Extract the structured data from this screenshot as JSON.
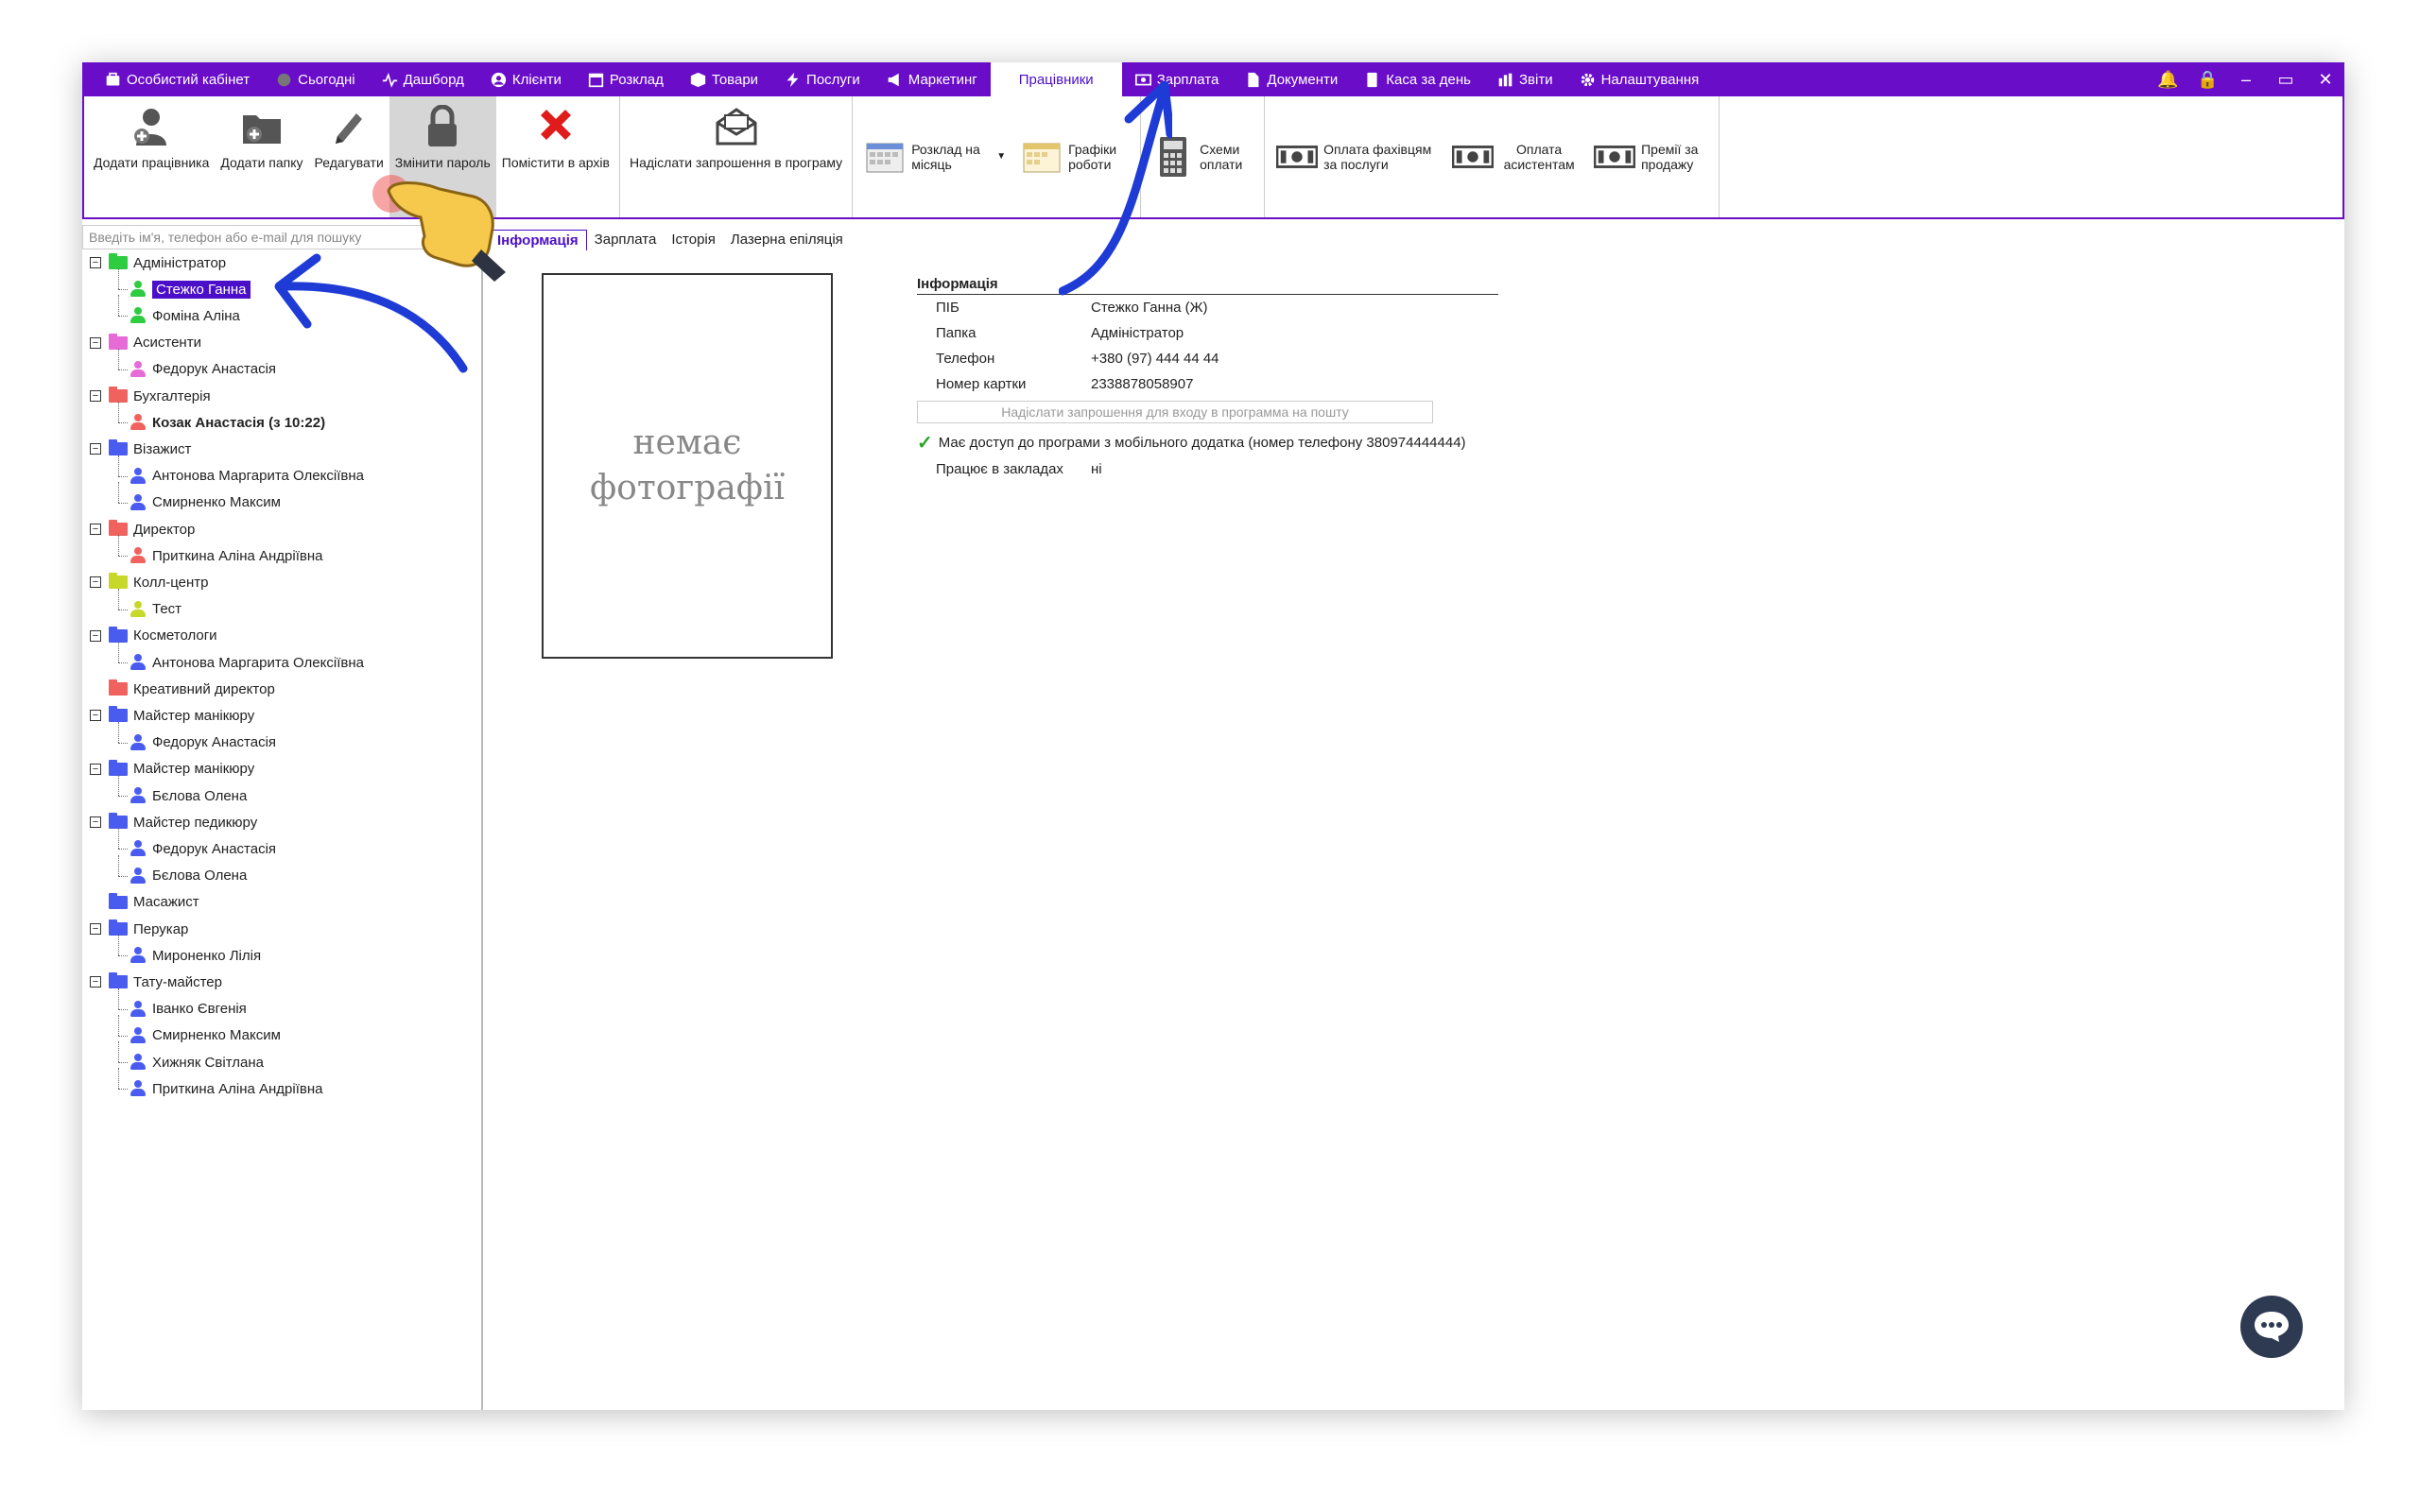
{
  "topnav": [
    {
      "label": "Особистий кабінет",
      "icon": "cabinet-icon"
    },
    {
      "label": "Сьогодні",
      "icon": "clock-icon"
    },
    {
      "label": "Дашборд",
      "icon": "pulse-icon"
    },
    {
      "label": "Клієнти",
      "icon": "user-icon"
    },
    {
      "label": "Розклад",
      "icon": "calendar-icon"
    },
    {
      "label": "Товари",
      "icon": "box-icon"
    },
    {
      "label": "Послуги",
      "icon": "bolt-icon"
    },
    {
      "label": "Маркетинг",
      "icon": "megaphone-icon"
    },
    {
      "label": "Працівники",
      "icon": "",
      "active": true
    },
    {
      "label": "Зарплата",
      "icon": "money-icon"
    },
    {
      "label": "Документи",
      "icon": "document-icon"
    },
    {
      "label": "Каса за день",
      "icon": "calculator-icon"
    },
    {
      "label": "Звіти",
      "icon": "chart-icon"
    },
    {
      "label": "Налаштування",
      "icon": "gear-icon"
    }
  ],
  "window_controls": {
    "minimize": "–",
    "restore": "▭",
    "close": "✕"
  },
  "ribbon": {
    "add_employee": "Додати працівника",
    "add_folder": "Додати папку",
    "edit": "Редагувати",
    "change_password": "Змінити пароль",
    "archive": "Помістити в архів",
    "send_invite": "Надіслати запрошення в програму",
    "schedule_month": "Розклад на місяць",
    "work_schedules": "Графіки роботи",
    "pay_schemes": "Схеми оплати",
    "pay_services": "Оплата фахівцям за послуги",
    "pay_assistants": "Оплата асистентам",
    "sales_bonus": "Премії за продажу"
  },
  "search_placeholder": "Введіть ім'я, телефон або e-mail для пошуку",
  "tree": [
    {
      "type": "folder",
      "label": "Адміністратор",
      "color": "#2ecc40",
      "expander": "−"
    },
    {
      "type": "person",
      "label": "Стежко Ганна",
      "color": "#2ecc40",
      "selected": true
    },
    {
      "type": "person",
      "label": "Фоміна Аліна",
      "color": "#2ecc40"
    },
    {
      "type": "folder",
      "label": "Асистенти",
      "color": "#e66bd6",
      "expander": "−"
    },
    {
      "type": "person",
      "label": "Федорук Анастасія",
      "color": "#e66bd6"
    },
    {
      "type": "folder",
      "label": "Бухгалтерія",
      "color": "#f0625e",
      "expander": "−"
    },
    {
      "type": "person",
      "label": "Козак Анастасія (з 10:22)",
      "color": "#f0625e",
      "bold": true
    },
    {
      "type": "folder",
      "label": "Візажист",
      "color": "#4a5cf0",
      "expander": "−"
    },
    {
      "type": "person",
      "label": "Антонова Маргарита Олексіївна",
      "color": "#4a5cf0"
    },
    {
      "type": "person",
      "label": "Смирненко Максим",
      "color": "#4a5cf0"
    },
    {
      "type": "folder",
      "label": "Директор",
      "color": "#f0625e",
      "expander": "−"
    },
    {
      "type": "person",
      "label": "Приткина Аліна Андріївна",
      "color": "#f0625e"
    },
    {
      "type": "folder",
      "label": "Колл-центр",
      "color": "#c8d82a",
      "expander": "−"
    },
    {
      "type": "person",
      "label": "Тест",
      "color": "#c8d82a"
    },
    {
      "type": "folder",
      "label": "Косметологи",
      "color": "#4a5cf0",
      "expander": "−"
    },
    {
      "type": "person",
      "label": "Антонова Маргарита Олексіївна",
      "color": "#4a5cf0"
    },
    {
      "type": "folder",
      "label": "Креативний директор",
      "color": "#f0625e",
      "expander": ""
    },
    {
      "type": "folder",
      "label": "Майстер манікюру",
      "color": "#4a5cf0",
      "expander": "−"
    },
    {
      "type": "person",
      "label": "Федорук Анастасія",
      "color": "#4a5cf0"
    },
    {
      "type": "folder",
      "label": "Майстер манікюру",
      "color": "#4a5cf0",
      "expander": "−"
    },
    {
      "type": "person",
      "label": "Бєлова Олена",
      "color": "#4a5cf0"
    },
    {
      "type": "folder",
      "label": "Майстер педикюру",
      "color": "#4a5cf0",
      "expander": "−"
    },
    {
      "type": "person",
      "label": "Федорук Анастасія",
      "color": "#4a5cf0"
    },
    {
      "type": "person",
      "label": "Бєлова Олена",
      "color": "#4a5cf0"
    },
    {
      "type": "folder",
      "label": "Масажист",
      "color": "#4a5cf0",
      "expander": ""
    },
    {
      "type": "folder",
      "label": "Перукар",
      "color": "#4a5cf0",
      "expander": "−"
    },
    {
      "type": "person",
      "label": "Мироненко Лілія",
      "color": "#4a5cf0"
    },
    {
      "type": "folder",
      "label": "Тату-майстер",
      "color": "#4a5cf0",
      "expander": "−"
    },
    {
      "type": "person",
      "label": "Іванко Євгенія",
      "color": "#4a5cf0"
    },
    {
      "type": "person",
      "label": "Смирненко Максим",
      "color": "#4a5cf0"
    },
    {
      "type": "person",
      "label": "Хижняк Світлана",
      "color": "#4a5cf0"
    },
    {
      "type": "person",
      "label": "Приткина Аліна Андріївна",
      "color": "#4a5cf0"
    }
  ],
  "tabs": [
    "Інформація",
    "Зарплата",
    "Історія",
    "Лазерна епіляція"
  ],
  "photo_placeholder": "немає фотографії",
  "info": {
    "heading": "Інформація",
    "rows": [
      {
        "k": "ПІБ",
        "v": "Стежко Ганна (Ж)"
      },
      {
        "k": "Папка",
        "v": "Адміністратор"
      },
      {
        "k": "Телефон",
        "v": "+380 (97) 444 44 44"
      },
      {
        "k": "Номер картки",
        "v": "2338878058907"
      }
    ],
    "invite_button": "Надіслати запрошення для входу в программа на пошту",
    "mobile_access": "Має доступ до програми з мобільного додатка (номер телефону 380974444444)",
    "works_in_label": "Працює в закладах",
    "works_in_value": "ні"
  },
  "colors": {
    "accent": "#6a0dc9",
    "selected": "#4b0fc9",
    "arrow": "#1f3bd6"
  }
}
